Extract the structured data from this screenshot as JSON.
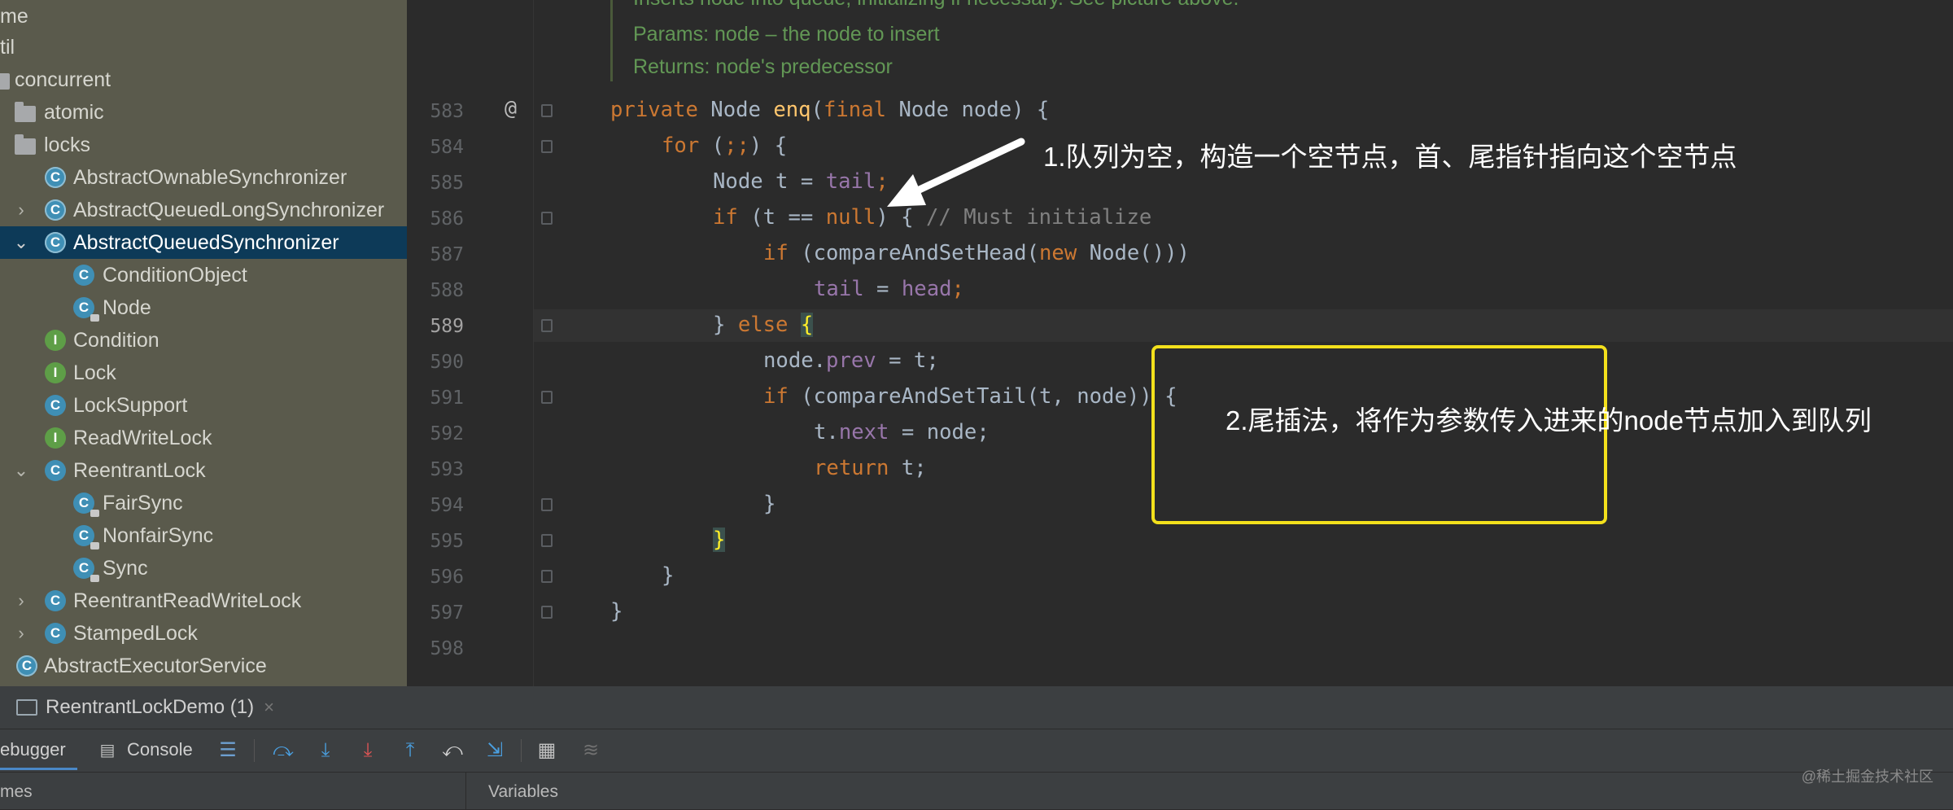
{
  "tree": {
    "items": [
      {
        "label": "me",
        "kind": "none",
        "arrow": ""
      },
      {
        "label": "til",
        "kind": "none",
        "arrow": ""
      },
      {
        "label": "concurrent",
        "kind": "folder",
        "arrow": ""
      },
      {
        "label": "atomic",
        "kind": "folder",
        "arrow": ""
      },
      {
        "label": "locks",
        "kind": "folder",
        "arrow": ""
      },
      {
        "label": "AbstractOwnableSynchronizer",
        "kind": "class-abstract",
        "arrow": ""
      },
      {
        "label": "AbstractQueuedLongSynchronizer",
        "kind": "class-abstract",
        "arrow": "›"
      },
      {
        "label": "AbstractQueuedSynchronizer",
        "kind": "class-abstract",
        "arrow": "⌄"
      },
      {
        "label": "ConditionObject",
        "kind": "class",
        "arrow": ""
      },
      {
        "label": "Node",
        "kind": "class-locked",
        "arrow": ""
      },
      {
        "label": "Condition",
        "kind": "interface",
        "arrow": ""
      },
      {
        "label": "Lock",
        "kind": "interface",
        "arrow": ""
      },
      {
        "label": "LockSupport",
        "kind": "class",
        "arrow": ""
      },
      {
        "label": "ReadWriteLock",
        "kind": "interface",
        "arrow": ""
      },
      {
        "label": "ReentrantLock",
        "kind": "class",
        "arrow": "⌄"
      },
      {
        "label": "FairSync",
        "kind": "class-locked",
        "arrow": ""
      },
      {
        "label": "NonfairSync",
        "kind": "class-locked",
        "arrow": ""
      },
      {
        "label": "Sync",
        "kind": "class-locked",
        "arrow": ""
      },
      {
        "label": "ReentrantReadWriteLock",
        "kind": "class",
        "arrow": "›"
      },
      {
        "label": "StampedLock",
        "kind": "class",
        "arrow": "›"
      },
      {
        "label": "AbstractExecutorService",
        "kind": "class-abstract",
        "arrow": ""
      }
    ]
  },
  "editor": {
    "doc_lines": [
      "Inserts node into queue, initializing if necessary. See picture above.",
      "Params:  node – the node to insert",
      "Returns: node's predecessor"
    ],
    "line_numbers": [
      "583",
      "584",
      "585",
      "586",
      "587",
      "588",
      "589",
      "590",
      "591",
      "592",
      "593",
      "594",
      "595",
      "596",
      "597",
      "598"
    ],
    "override_mark": "@",
    "code": {
      "l583_kw": "private ",
      "l583_type": "Node ",
      "l583_mth": "enq",
      "l583_a": "(",
      "l583_kw2": "final ",
      "l583_b": "Node node) {",
      "l584_kw": "for ",
      "l584_a": "(",
      "l584_b": ";;",
      "l584_c": ") {",
      "l585_a": "Node t = ",
      "l585_fld": "tail",
      "l585_b": ";",
      "l586_kw": "if ",
      "l586_a": "(t == ",
      "l586_kw2": "null",
      "l586_b": ") { ",
      "l586_cmt": "// Must initialize",
      "l587_kw": "if ",
      "l587_a": "(compareAndSetHead(",
      "l587_kw2": "new ",
      "l587_b": "Node()))",
      "l588_fld": "tail",
      "l588_a": " = ",
      "l588_fld2": "head",
      "l588_b": ";",
      "l589_a": "} ",
      "l589_kw": "else ",
      "l589_b": "{",
      "l590_a": "node.",
      "l590_fld": "prev",
      "l590_b": " = t;",
      "l591_kw": "if ",
      "l591_a": "(compareAndSetTail(t, node)) {",
      "l592_a": "t.",
      "l592_fld": "next",
      "l592_b": " = node;",
      "l593_kw": "return ",
      "l593_a": "t;",
      "l594_a": "}",
      "l595_a": "}",
      "l596_a": "}",
      "l597_a": "}"
    },
    "annotations": {
      "first": "1.队列为空，构造一个空节点，首、尾指针指向这个空节点",
      "second": "2.尾插法，将作为参数传入进来的node节点加入到队列"
    }
  },
  "bottom": {
    "run_tab_label": "ReentrantLockDemo (1)",
    "run_tab_close": "×",
    "debugger_label": "ebugger",
    "console_label": "Console",
    "frames_label": "mes",
    "variables_label": "Variables",
    "watermark": "@稀土掘金技术社区"
  },
  "colors": {
    "accent": "#4a88c7",
    "highlight_box": "#f3e01c",
    "selection": "#0d3a58"
  }
}
